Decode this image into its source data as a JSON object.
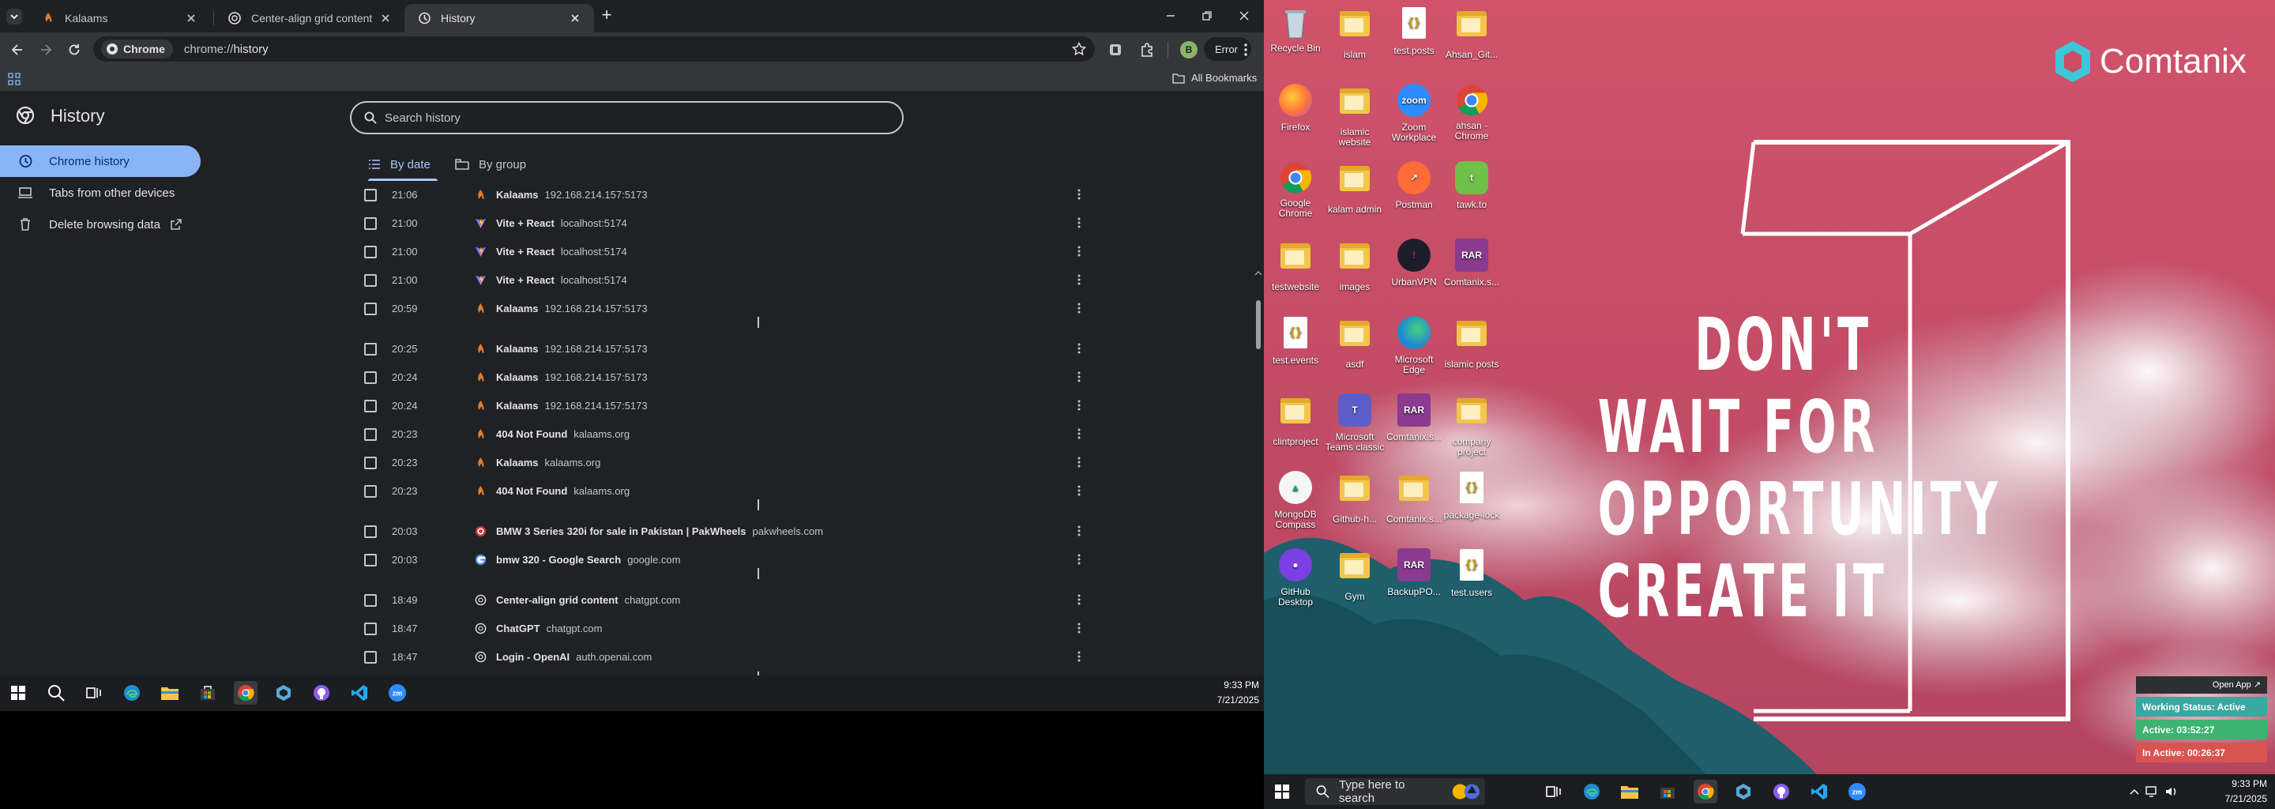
{
  "browser": {
    "tabs": [
      {
        "title": "Kalaams",
        "icon": "kalaams-favicon",
        "active": false
      },
      {
        "title": "Center-align grid content",
        "icon": "chatgpt-favicon",
        "active": false
      },
      {
        "title": "History",
        "icon": "history-icon",
        "active": true
      }
    ],
    "new_tab_symbol": "+",
    "omnibox": {
      "chip": "Chrome",
      "url_scheme": "chrome://",
      "url_path": "history"
    },
    "profile_letter": "B",
    "error_label": "Error",
    "bookmarks": {
      "all_bookmarks": "All Bookmarks"
    }
  },
  "history": {
    "title": "History",
    "search_placeholder": "Search history",
    "sidebar": [
      {
        "label": "Chrome history",
        "icon": "history-icon",
        "active": true
      },
      {
        "label": "Tabs from other devices",
        "icon": "laptop-icon",
        "active": false
      },
      {
        "label": "Delete browsing data",
        "icon": "trash-icon",
        "active": false
      }
    ],
    "group_tabs": [
      {
        "label": "By date",
        "icon": "list-icon",
        "active": true
      },
      {
        "label": "By group",
        "icon": "tabs-group-icon",
        "active": false
      }
    ],
    "entries": [
      {
        "time": "21:06",
        "title": "Kalaams",
        "domain": "192.168.214.157:5173",
        "favicon": "kalaams"
      },
      {
        "time": "21:00",
        "title": "Vite + React",
        "domain": "localhost:5174",
        "favicon": "vite"
      },
      {
        "time": "21:00",
        "title": "Vite + React",
        "domain": "localhost:5174",
        "favicon": "vite"
      },
      {
        "time": "21:00",
        "title": "Vite + React",
        "domain": "localhost:5174",
        "favicon": "vite"
      },
      {
        "time": "20:59",
        "title": "Kalaams",
        "domain": "192.168.214.157:5173",
        "favicon": "kalaams"
      },
      {
        "time": "20:25",
        "title": "Kalaams",
        "domain": "192.168.214.157:5173",
        "favicon": "kalaams"
      },
      {
        "time": "20:24",
        "title": "Kalaams",
        "domain": "192.168.214.157:5173",
        "favicon": "kalaams"
      },
      {
        "time": "20:24",
        "title": "Kalaams",
        "domain": "192.168.214.157:5173",
        "favicon": "kalaams"
      },
      {
        "time": "20:23",
        "title": "404 Not Found",
        "domain": "kalaams.org",
        "favicon": "kalaams"
      },
      {
        "time": "20:23",
        "title": "Kalaams",
        "domain": "kalaams.org",
        "favicon": "kalaams"
      },
      {
        "time": "20:23",
        "title": "404 Not Found",
        "domain": "kalaams.org",
        "favicon": "kalaams"
      },
      {
        "time": "20:03",
        "title": "BMW 3 Series 320i for sale in Pakistan | PakWheels",
        "domain": "pakwheels.com",
        "favicon": "pakwheels"
      },
      {
        "time": "20:03",
        "title": "bmw 320 - Google Search",
        "domain": "google.com",
        "favicon": "google"
      },
      {
        "time": "18:49",
        "title": "Center-align grid content",
        "domain": "chatgpt.com",
        "favicon": "chatgpt"
      },
      {
        "time": "18:47",
        "title": "ChatGPT",
        "domain": "chatgpt.com",
        "favicon": "chatgpt"
      },
      {
        "time": "18:47",
        "title": "Login - OpenAI",
        "domain": "auth.openai.com",
        "favicon": "chatgpt"
      }
    ]
  },
  "taskbar_left": {
    "time": "9:33 PM",
    "date": "7/21/2025",
    "apps": [
      "start-icon",
      "search-icon",
      "task-view-icon",
      "edge-icon",
      "file-explorer-icon",
      "store-icon",
      "chrome-icon",
      "app-icon",
      "github-desktop-icon",
      "vscode-icon",
      "zoom-icon"
    ]
  },
  "desktop": {
    "brand": "Comtanix",
    "motto": [
      "DON'T",
      "WAIT FOR",
      "OPPORTUNITY",
      "CREATE IT"
    ],
    "icons": [
      {
        "label": "Recycle Bin",
        "kind": "bin"
      },
      {
        "label": "islam",
        "kind": "folder"
      },
      {
        "label": "test.posts",
        "kind": "js"
      },
      {
        "label": "Ahsan_Git...",
        "kind": "folder"
      },
      {
        "label": "Firefox",
        "kind": "firefox"
      },
      {
        "label": "islamic website",
        "kind": "folder"
      },
      {
        "label": "Zoom Workplace",
        "kind": "zoom"
      },
      {
        "label": "ahsan - Chrome",
        "kind": "chrome"
      },
      {
        "label": "Google Chrome",
        "kind": "chrome"
      },
      {
        "label": "kalam admin",
        "kind": "folder"
      },
      {
        "label": "Postman",
        "kind": "postman"
      },
      {
        "label": "tawk.to",
        "kind": "tawk"
      },
      {
        "label": "testwebsite",
        "kind": "folder"
      },
      {
        "label": "images",
        "kind": "folder"
      },
      {
        "label": "UrbanVPN",
        "kind": "vpn"
      },
      {
        "label": "Comtanix.s...",
        "kind": "rar"
      },
      {
        "label": "test.events",
        "kind": "js"
      },
      {
        "label": "asdf",
        "kind": "folder"
      },
      {
        "label": "Microsoft Edge",
        "kind": "edge"
      },
      {
        "label": "islamic posts",
        "kind": "folder"
      },
      {
        "label": "clintproject",
        "kind": "folder"
      },
      {
        "label": "Microsoft Teams classic",
        "kind": "teams"
      },
      {
        "label": "Comtanix.s...",
        "kind": "rar"
      },
      {
        "label": "company project",
        "kind": "folder"
      },
      {
        "label": "MongoDB Compass",
        "kind": "mongo"
      },
      {
        "label": "Github-h...",
        "kind": "folder"
      },
      {
        "label": "Comtanix.s...",
        "kind": "folder"
      },
      {
        "label": "package-lock",
        "kind": "js"
      },
      {
        "label": "GitHub Desktop",
        "kind": "github"
      },
      {
        "label": "Gym",
        "kind": "folder"
      },
      {
        "label": "BackupPO...",
        "kind": "rar"
      },
      {
        "label": "test.users",
        "kind": "js"
      }
    ],
    "work_tracker": {
      "open_app": "Open App ↗",
      "status": "Working Status: Active",
      "active": "Active: 03:52:27",
      "inactive": "In Active: 00:26:37",
      "colors": {
        "status": "#3aa7a0",
        "active": "#3cb371",
        "inactive": "#d9534f"
      }
    }
  },
  "taskbar_right": {
    "search_placeholder": "Type here to search",
    "time": "9:33 PM",
    "date": "7/21/2025"
  }
}
